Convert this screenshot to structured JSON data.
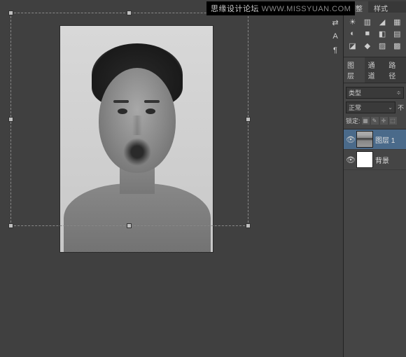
{
  "watermark": {
    "text": "思缘设计论坛",
    "url": "WWW.MISSYUAN.COM"
  },
  "top_tabs": {
    "adjustments": "调整",
    "styles": "样式"
  },
  "tool_column": {
    "swap": "⇄",
    "text": "A",
    "para": "¶"
  },
  "adjust_icons": {
    "r1": [
      "☀",
      "▥",
      "◢",
      "▦"
    ],
    "r2": [
      "◐",
      "■",
      "◧",
      "▤"
    ],
    "r3": [
      "◪",
      "◆",
      "▨",
      "▩"
    ]
  },
  "panel_tabs": {
    "layers": "图层",
    "channels": "通道",
    "paths": "路径"
  },
  "layer_panel": {
    "kind": "类型",
    "blend": "正常",
    "opacity_label": "不",
    "lock_label": "锁定:",
    "icons": [
      "▦",
      "✎",
      "✛",
      "⬚"
    ]
  },
  "layers": [
    {
      "name": "图层 1",
      "selected": true,
      "thumb": "portrait"
    },
    {
      "name": "背景",
      "selected": false,
      "thumb": "white"
    }
  ]
}
